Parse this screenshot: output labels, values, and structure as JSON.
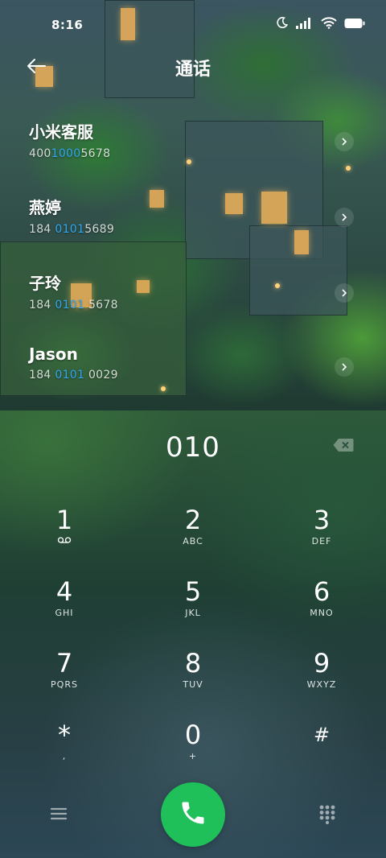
{
  "status": {
    "time": "8:16",
    "icons": [
      "moon-icon",
      "signal-icon",
      "wifi-icon",
      "battery-icon"
    ]
  },
  "header": {
    "title": "通话",
    "back_icon": "back-arrow-icon"
  },
  "contacts": [
    {
      "name": "小米客服",
      "number_pre": "400",
      "number_hl": "1000",
      "number_post": "5678"
    },
    {
      "name": "燕婷",
      "number_pre": "184 ",
      "number_hl": "0101",
      "number_post": "5689"
    },
    {
      "name": "子玲",
      "number_pre": "184 ",
      "number_hl": "0101",
      "number_post": " 5678"
    },
    {
      "name": "Jason",
      "number_pre": "184 ",
      "number_hl": "0101",
      "number_post": " 0029"
    }
  ],
  "dial": {
    "number": "010",
    "backspace_icon": "backspace-icon"
  },
  "keys": [
    {
      "digit": "1",
      "letters": "",
      "icon": "voicemail-icon"
    },
    {
      "digit": "2",
      "letters": "ABC"
    },
    {
      "digit": "3",
      "letters": "DEF"
    },
    {
      "digit": "4",
      "letters": "GHI"
    },
    {
      "digit": "5",
      "letters": "JKL"
    },
    {
      "digit": "6",
      "letters": "MNO"
    },
    {
      "digit": "7",
      "letters": "PQRS"
    },
    {
      "digit": "8",
      "letters": "TUV"
    },
    {
      "digit": "9",
      "letters": "WXYZ"
    },
    {
      "digit": "*",
      "letters": ","
    },
    {
      "digit": "0",
      "letters": "+"
    },
    {
      "digit": "#",
      "letters": ""
    }
  ],
  "bottom": {
    "menu_icon": "menu-icon",
    "call_icon": "phone-icon",
    "dialpad_icon": "dialpad-icon",
    "call_color": "#1fbf5a"
  },
  "colors": {
    "highlight": "#2fa7f5"
  }
}
